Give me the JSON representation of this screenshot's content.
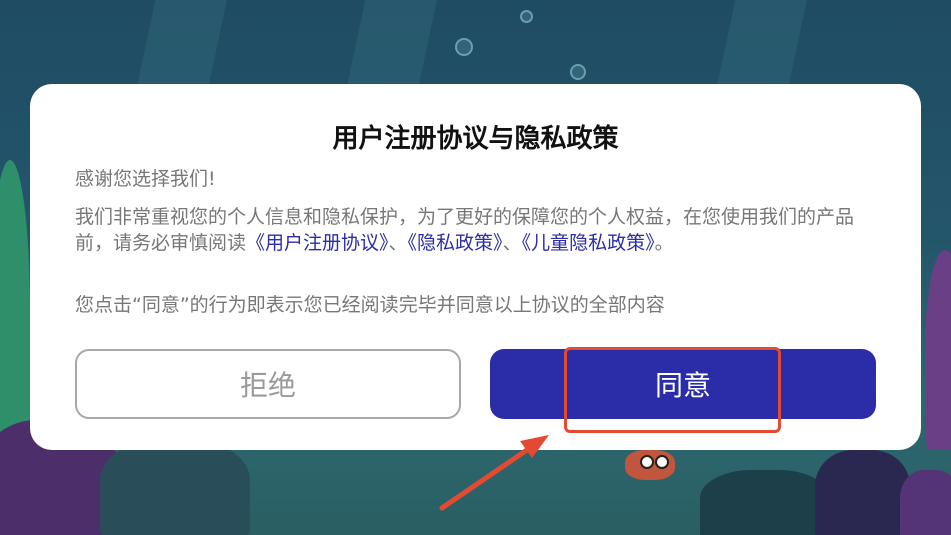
{
  "dialog": {
    "title": "用户注册协议与隐私政策",
    "thanks": "感谢您选择我们!",
    "body_prefix": "我们非常重视您的个人信息和隐私保护，为了更好的保障您的个人权益，在您使用我们的产品前，请务必审慎阅读",
    "link_user_agreement": "《用户注册协议》",
    "sep1": "、",
    "link_privacy_policy": "《隐私政策》",
    "sep2": "、",
    "link_child_privacy": "《儿童隐私政策》",
    "body_suffix": "。",
    "consent": "您点击“同意”的行为即表示您已经阅读完毕并同意以上协议的全部内容",
    "reject_label": "拒绝",
    "agree_label": "同意"
  },
  "colors": {
    "accent": "#2b2ca8",
    "annotation": "#e24a32",
    "background": "#24566b"
  },
  "annotation": {
    "type": "highlight-box-with-arrow",
    "target": "agree-button"
  }
}
